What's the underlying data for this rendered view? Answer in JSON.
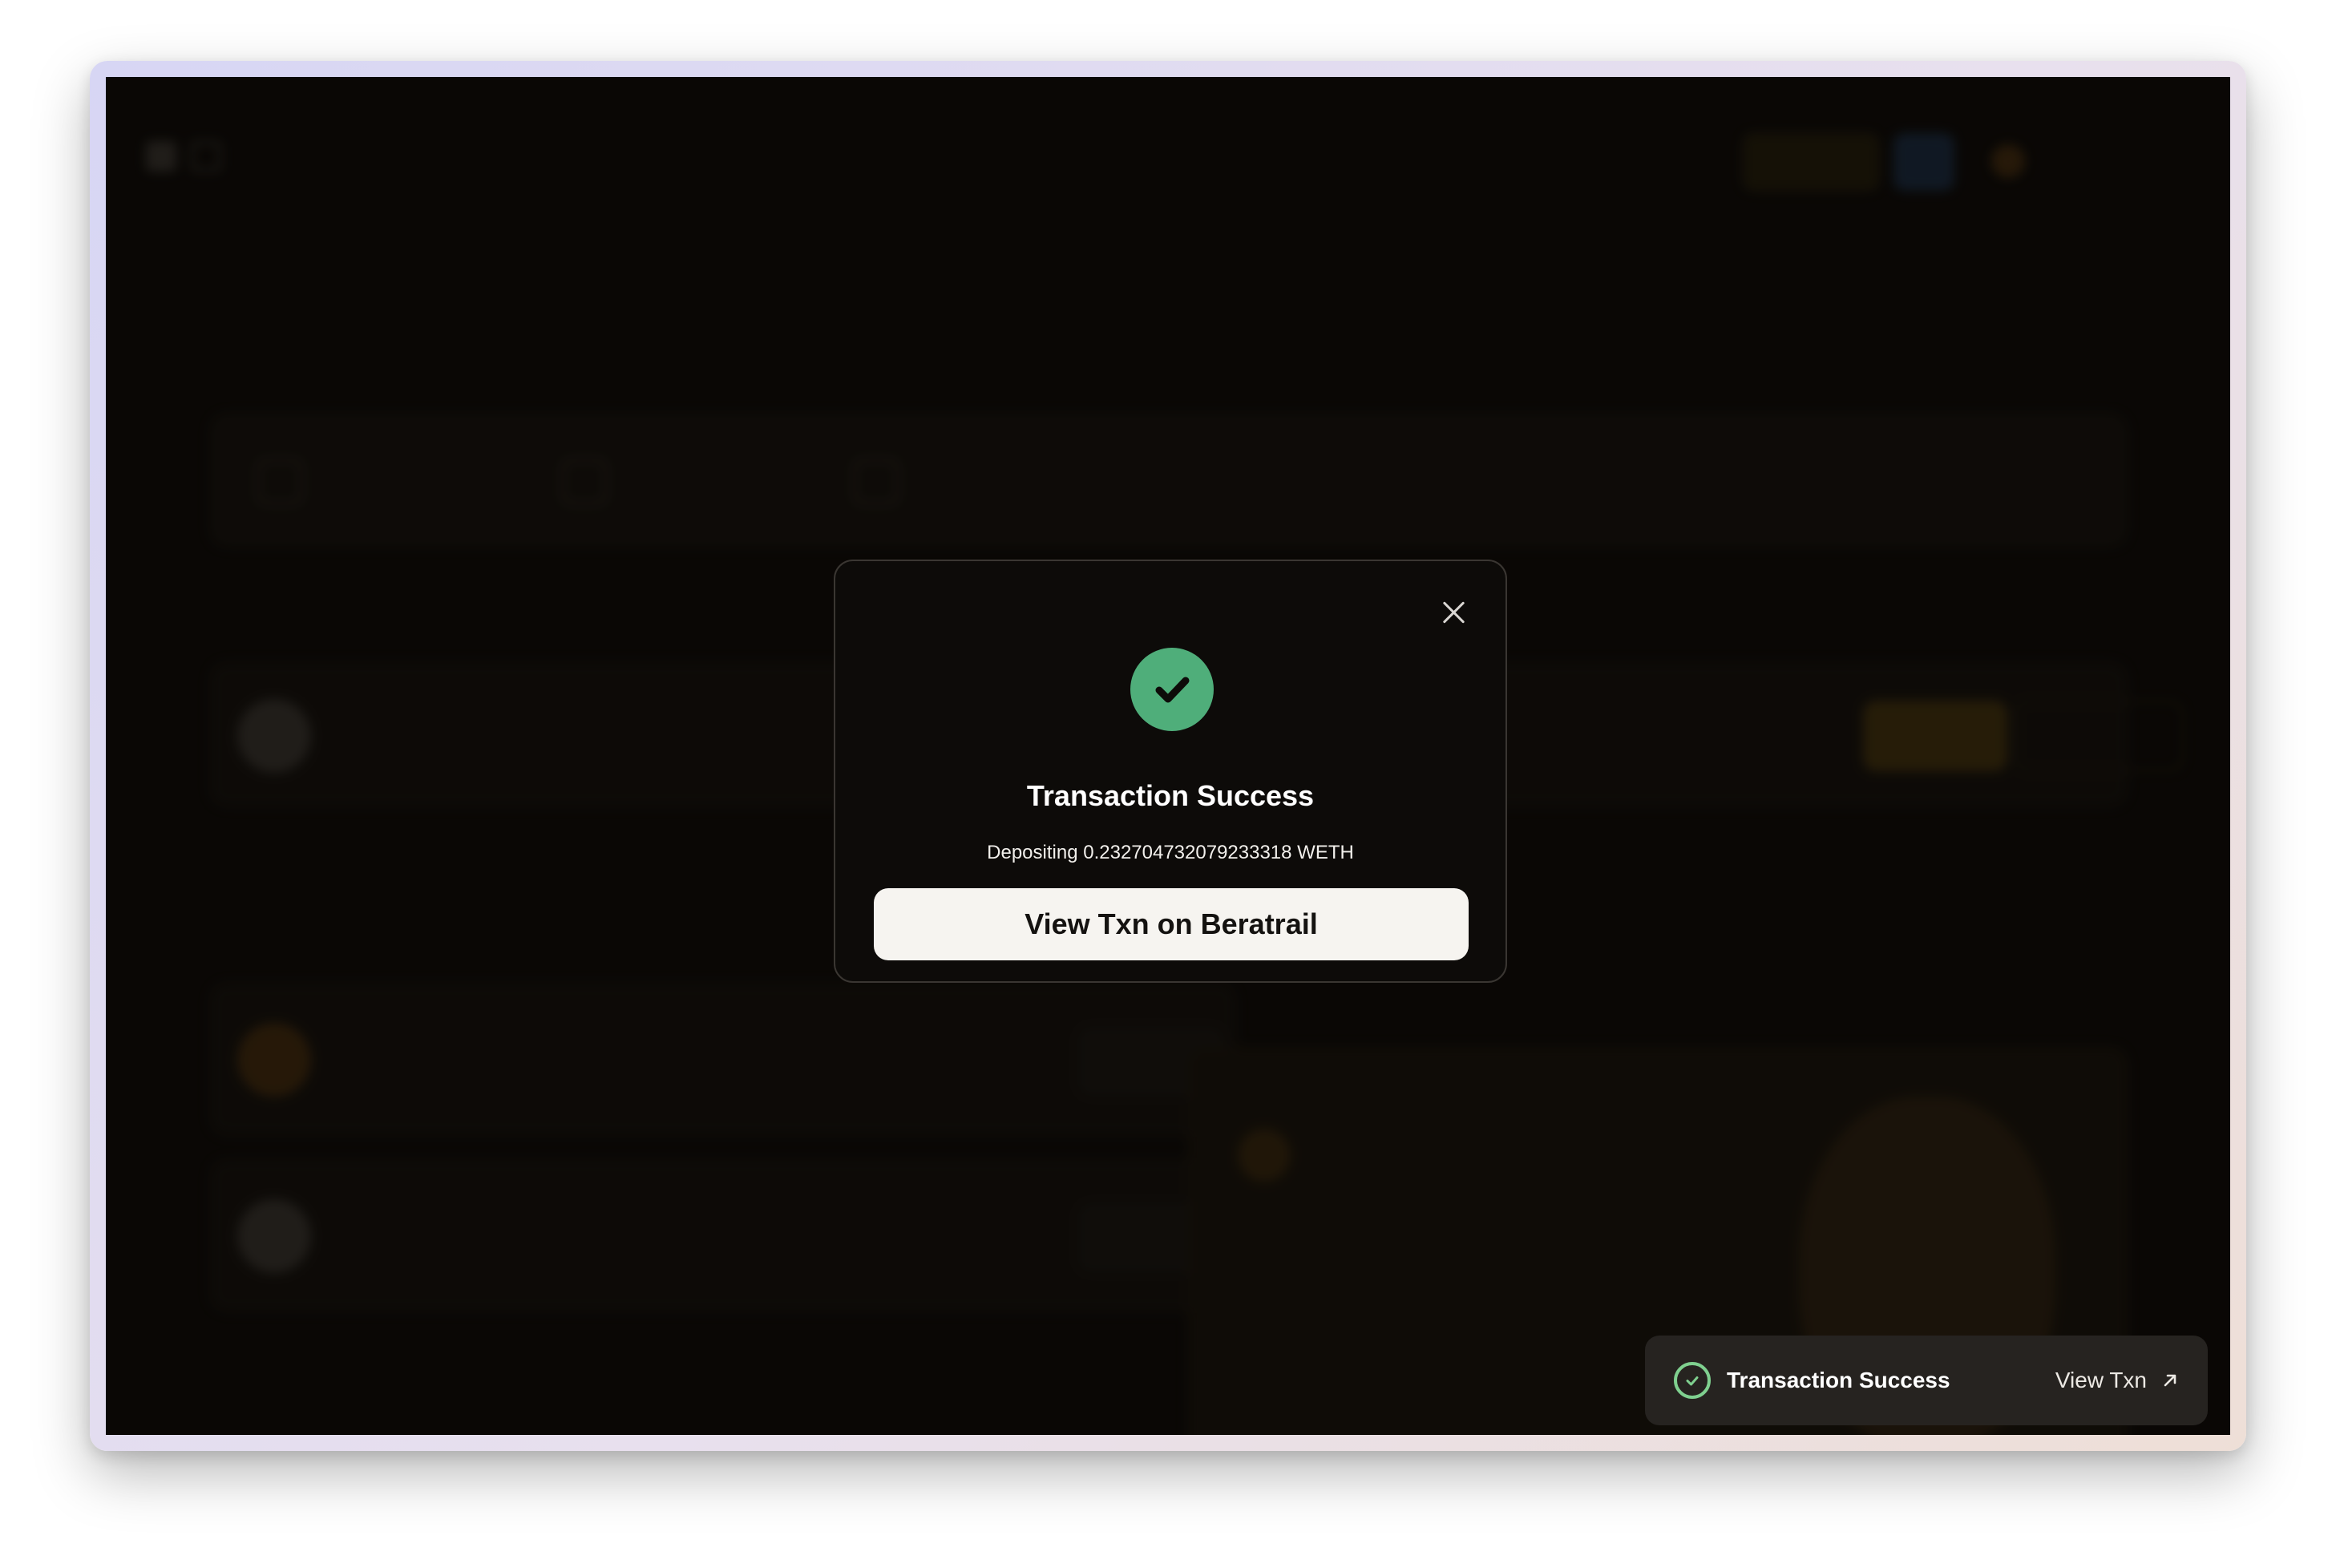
{
  "modal": {
    "title": "Transaction Success",
    "description": "Depositing 0.232704732079233318 WETH",
    "primary_button": "View Txn on Beratrail",
    "success_color": "#4fae7a"
  },
  "toast": {
    "title": "Transaction Success",
    "link_label": "View Txn",
    "icon_color": "#7fd08f"
  },
  "icons": {
    "close": "close-icon",
    "success": "check-circle-icon",
    "external_link": "arrow-up-right-icon"
  }
}
